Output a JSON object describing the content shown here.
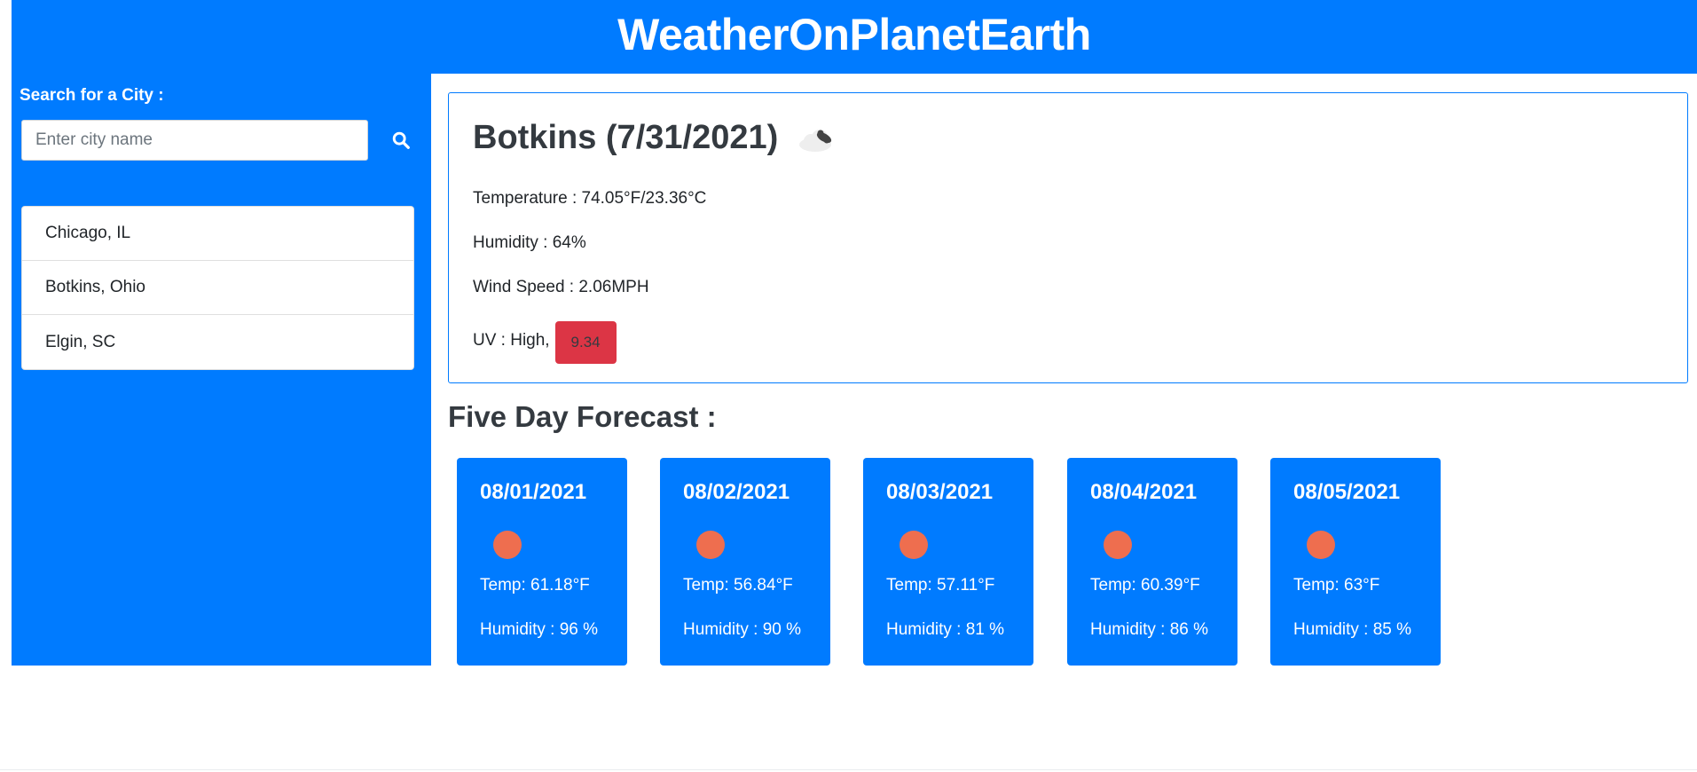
{
  "header": {
    "title": "WeatherOnPlanetEarth"
  },
  "sidebar": {
    "search_label": "Search for a City :",
    "search_placeholder": "Enter city name",
    "search_value": "",
    "search_icon": "search-icon",
    "cities": [
      {
        "label": "Chicago, IL"
      },
      {
        "label": "Botkins, Ohio"
      },
      {
        "label": "Elgin, SC"
      }
    ]
  },
  "current": {
    "title": "Botkins (7/31/2021)",
    "icon": "broken-clouds-icon",
    "temperature": "Temperature : 74.05°F/23.36°C",
    "humidity": "Humidity : 64%",
    "wind": "Wind Speed : 2.06MPH",
    "uv_label": "UV : High,",
    "uv_value": "9.34",
    "uv_color": "#dc3545"
  },
  "forecast": {
    "title": "Five Day Forecast :",
    "days": [
      {
        "date": "08/01/2021",
        "icon": "weather-icon",
        "temp": "Temp: 61.18°F",
        "humidity": "Humidity : 96 %"
      },
      {
        "date": "08/02/2021",
        "icon": "weather-icon",
        "temp": "Temp: 56.84°F",
        "humidity": "Humidity : 90 %"
      },
      {
        "date": "08/03/2021",
        "icon": "weather-icon",
        "temp": "Temp: 57.11°F",
        "humidity": "Humidity : 81 %"
      },
      {
        "date": "08/04/2021",
        "icon": "weather-icon",
        "temp": "Temp: 60.39°F",
        "humidity": "Humidity : 86 %"
      },
      {
        "date": "08/05/2021",
        "icon": "weather-icon",
        "temp": "Temp: 63°F",
        "humidity": "Humidity : 85 %"
      }
    ]
  },
  "colors": {
    "primary": "#007bff",
    "danger": "#dc3545",
    "forecast_icon": "#ee6e4f"
  }
}
